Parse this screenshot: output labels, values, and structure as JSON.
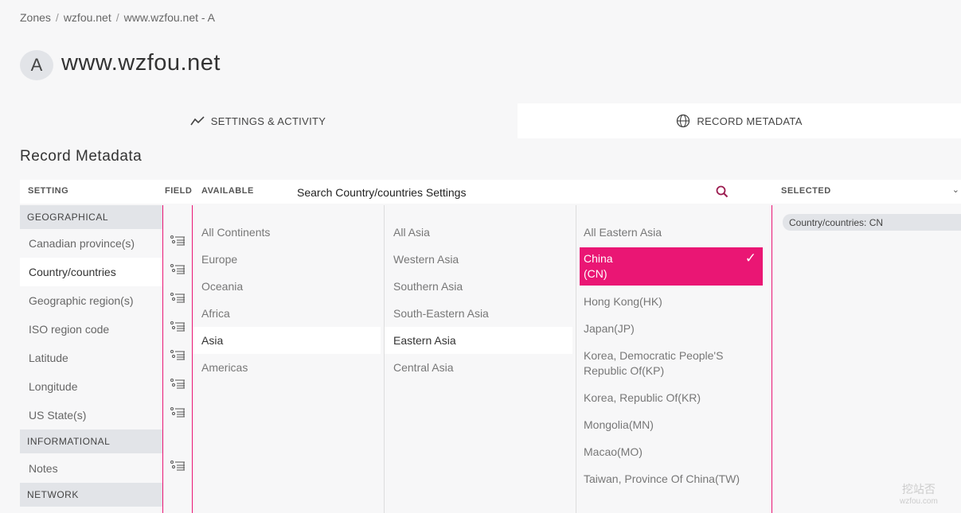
{
  "breadcrumb": {
    "items": [
      "Zones",
      "wzfou.net",
      "www.wzfou.net - A"
    ],
    "sep": "/"
  },
  "record": {
    "type": "A",
    "name": "www.wzfou.net"
  },
  "tabs": [
    {
      "label": "SETTINGS & ACTIVITY",
      "icon": "chart-line-icon"
    },
    {
      "label": "RECORD METADATA",
      "icon": "globe-icon",
      "active": true
    }
  ],
  "section_title": "Record Metadata",
  "columns": {
    "setting": "SETTING",
    "field": "FIELD",
    "available": "AVAILABLE",
    "selected": "SELECTED"
  },
  "search": {
    "placeholder": "Search Country/countries Settings"
  },
  "categories": [
    {
      "header": "GEOGRAPHICAL",
      "items": [
        "Canadian province(s)",
        "Country/countries",
        "Geographic region(s)",
        "ISO region code",
        "Latitude",
        "Longitude",
        "US State(s)"
      ]
    },
    {
      "header": "INFORMATIONAL",
      "items": [
        "Notes"
      ]
    },
    {
      "header": "NETWORK",
      "items": []
    }
  ],
  "continents": [
    "All Continents",
    "Europe",
    "Oceania",
    "Africa",
    "Asia",
    "Americas"
  ],
  "regions": [
    "All Asia",
    "Western Asia",
    "Southern Asia",
    "South-Eastern Asia",
    "Eastern Asia",
    "Central Asia"
  ],
  "countries": {
    "all": "All Eastern Asia",
    "selected": {
      "line1": "China",
      "line2": "(CN)",
      "check": "✓"
    },
    "items": [
      "Hong Kong(HK)",
      "Japan(JP)",
      "Korea, Democratic People'S Republic Of(KP)",
      "Korea, Republic Of(KR)",
      "Mongolia(MN)",
      "Macao(MO)",
      "Taiwan, Province Of China(TW)"
    ]
  },
  "selected_chip": "Country/countries:  CN",
  "watermark": {
    "line1": "挖站否",
    "line2": "wzfou.com"
  },
  "colors": {
    "accent": "#ea1674",
    "bg": "#f7f7f8",
    "header_gray": "#e2e4e8"
  }
}
